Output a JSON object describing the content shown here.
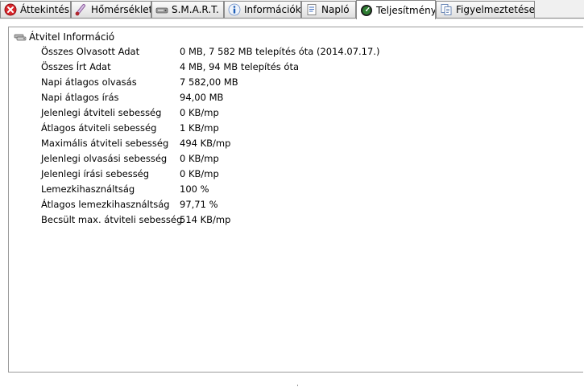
{
  "tabs": [
    {
      "label": "Áttekintés",
      "icon": "error-icon"
    },
    {
      "label": "Hőmérséklet",
      "icon": "thermometer-icon"
    },
    {
      "label": "S.M.A.R.T.",
      "icon": "hdd-icon"
    },
    {
      "label": "Információk",
      "icon": "info-icon"
    },
    {
      "label": "Napló",
      "icon": "log-icon"
    },
    {
      "label": "Teljesítmény",
      "icon": "gauge-icon"
    },
    {
      "label": "Figyelmeztetések",
      "icon": "alerts-icon"
    }
  ],
  "active_tab": "Teljesítmény",
  "section": {
    "title": "Átvitel Információ",
    "rows": [
      {
        "label": "Összes Olvasott Adat",
        "value": "0 MB,  7 582 MB telepítés óta  (2014.07.17.)"
      },
      {
        "label": "Összes Írt Adat",
        "value": "4 MB,  94 MB telepítés óta"
      },
      {
        "label": "Napi átlagos olvasás",
        "value": "7 582,00 MB"
      },
      {
        "label": "Napi átlagos írás",
        "value": "94,00 MB"
      },
      {
        "label": "Jelenlegi átviteli sebesség",
        "value": "0 KB/mp"
      },
      {
        "label": "Átlagos átviteli sebesség",
        "value": "1 KB/mp"
      },
      {
        "label": "Maximális átviteli sebesség",
        "value": "494 KB/mp"
      },
      {
        "label": "Jelenlegi olvasási sebesség",
        "value": "0 KB/mp"
      },
      {
        "label": "Jelenlegi írási sebesség",
        "value": "0 KB/mp"
      },
      {
        "label": "Lemezkihasználtság",
        "value": "100 %"
      },
      {
        "label": "Átlagos lemezkihasználtság",
        "value": "97,71 %"
      },
      {
        "label": "Becsült max. átviteli sebesség",
        "value": "514 KB/mp"
      }
    ]
  },
  "colors": {
    "error": "#d9262c",
    "info": "#1f5fb8",
    "gauge": "#2e7d32"
  }
}
